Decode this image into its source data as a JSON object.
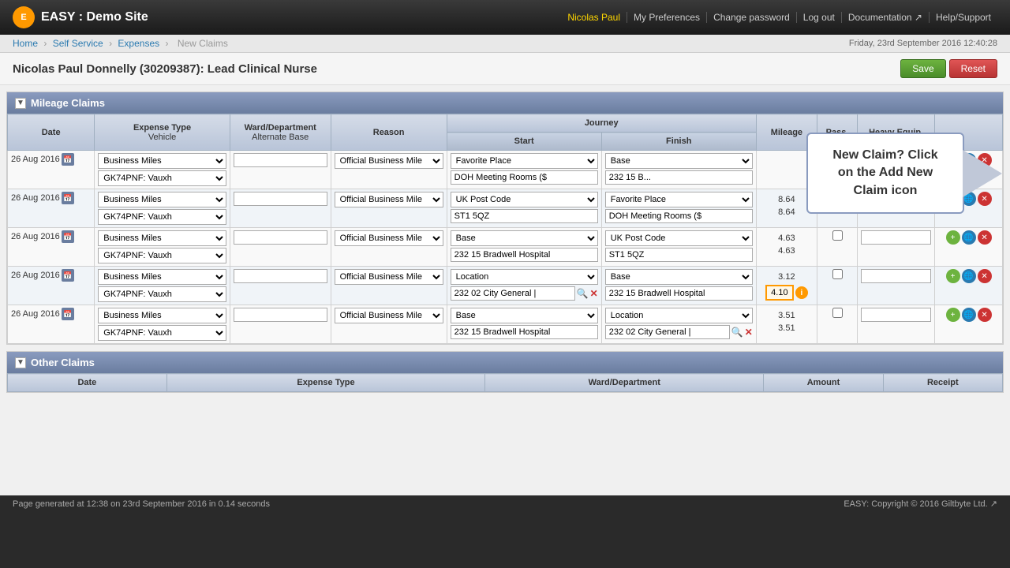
{
  "app": {
    "logo_text": "E",
    "site_title": "EASY : Demo Site"
  },
  "top_nav": {
    "user_name": "Nicolas Paul",
    "preferences_label": "My Preferences",
    "change_password_label": "Change password",
    "logout_label": "Log out",
    "documentation_label": "Documentation ↗",
    "help_label": "Help/Support"
  },
  "breadcrumb": {
    "home": "Home",
    "self_service": "Self Service",
    "expenses": "Expenses",
    "current": "New Claims"
  },
  "timestamp": "Friday, 23rd September 2016 12:40:28",
  "page_title": "Nicolas Paul Donnelly (30209387): Lead Clinical Nurse",
  "buttons": {
    "save": "Save",
    "reset": "Reset"
  },
  "mileage_section": {
    "title": "Mileage Claims",
    "columns": {
      "date": "Date",
      "expense_type": "Expense Type",
      "expense_vehicle": "Vehicle",
      "ward_dept": "Ward/Department",
      "alt_base": "Alternate Base",
      "reason": "Reason",
      "journey": "Journey",
      "start": "Start",
      "finish": "Finish",
      "mileage": "Mileage",
      "pass": "Pass.",
      "heavy_equip": "Heavy Equip."
    },
    "rows": [
      {
        "date": "26 Aug 2016",
        "expense_type": "Business Miles",
        "vehicle": "GK74PNF: Vauxh",
        "ward": "",
        "reason": "Official Business Mile",
        "start_type": "Favorite Place",
        "start_value": "",
        "finish_type": "Base",
        "finish_value": "232 15 B...",
        "mileage": "",
        "mileage2": ""
      },
      {
        "date": "26 Aug 2016",
        "expense_type": "Business Miles",
        "vehicle": "GK74PNF: Vauxh",
        "ward": "",
        "reason": "Official Business Mile",
        "start_type": "UK Post Code",
        "start_value": "ST1 5QZ",
        "finish_type": "Favorite Place",
        "finish_value": "DOH Meeting Rooms ($",
        "mileage": "8.64",
        "mileage2": "8.64"
      },
      {
        "date": "26 Aug 2016",
        "expense_type": "Business Miles",
        "vehicle": "GK74PNF: Vauxh",
        "ward": "",
        "reason": "Official Business Mile",
        "start_type": "Base",
        "start_value": "232 15 Bradwell Hospital",
        "finish_type": "UK Post Code",
        "finish_value": "ST1 5QZ",
        "mileage": "4.63",
        "mileage2": "4.63"
      },
      {
        "date": "26 Aug 2016",
        "expense_type": "Business Miles",
        "vehicle": "GK74PNF: Vauxh",
        "ward": "",
        "reason": "Official Business Mile",
        "start_type": "Location",
        "start_value": "232 02 City General |",
        "finish_type": "Base",
        "finish_value": "232 15 Bradwell Hospital",
        "mileage": "3.12",
        "mileage_input": "4.10",
        "has_info": true
      },
      {
        "date": "26 Aug 2016",
        "expense_type": "Business Miles",
        "vehicle": "GK74PNF: Vauxh",
        "ward": "",
        "reason": "Official Business Mile",
        "start_type": "Base",
        "start_value": "232 15 Bradwell Hospital",
        "finish_type": "Location",
        "finish_value": "232 02 City General |",
        "mileage": "3.51",
        "mileage2": "3.51"
      }
    ]
  },
  "callout": {
    "text": "New Claim? Click on the Add New Claim icon"
  },
  "other_claims": {
    "title": "Other Claims",
    "columns": {
      "date": "Date",
      "expense_type": "Expense Type",
      "ward_dept": "Ward/Department",
      "amount": "Amount",
      "receipt": "Receipt"
    }
  },
  "footer": {
    "left": "Page generated at 12:38 on 23rd September 2016 in 0.14 seconds",
    "right": "EASY: Copyright © 2016 Giltbyte Ltd. ↗"
  }
}
